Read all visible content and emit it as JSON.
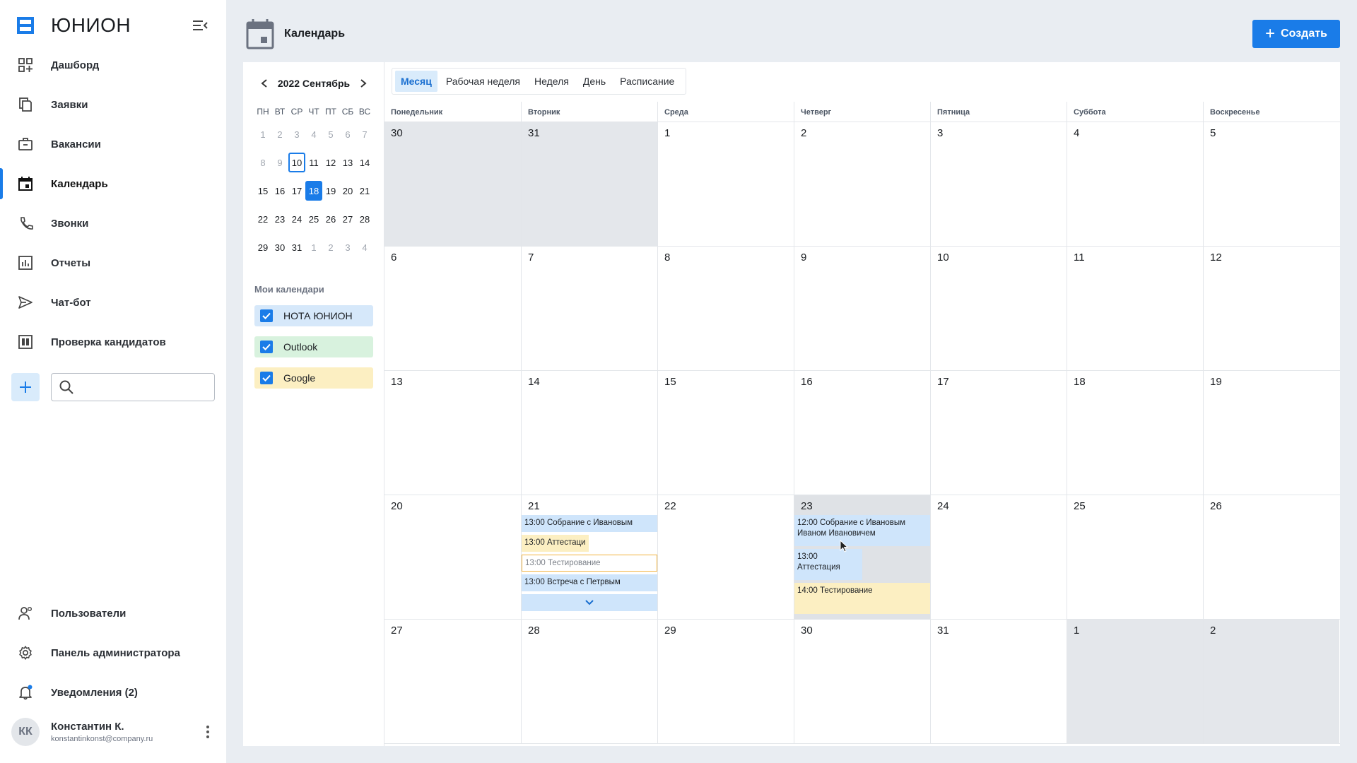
{
  "brand": {
    "name": "ЮНИОН"
  },
  "nav": [
    {
      "label": "Дашборд",
      "icon": "dashboard-icon"
    },
    {
      "label": "Заявки",
      "icon": "documents-icon"
    },
    {
      "label": "Вакансии",
      "icon": "briefcase-icon"
    },
    {
      "label": "Календарь",
      "icon": "calendar-icon",
      "active": true
    },
    {
      "label": "Звонки",
      "icon": "phone-icon"
    },
    {
      "label": "Отчеты",
      "icon": "reports-icon"
    },
    {
      "label": "Чат-бот",
      "icon": "send-icon"
    },
    {
      "label": "Проверка кандидатов",
      "icon": "candidates-icon"
    }
  ],
  "search": {
    "value": "",
    "placeholder": ""
  },
  "bottom_nav": [
    {
      "label": "Пользователи",
      "icon": "users-icon"
    },
    {
      "label": "Панель администратора",
      "icon": "gear-icon"
    },
    {
      "label": "Уведомления (2)",
      "icon": "bell-icon"
    }
  ],
  "user": {
    "initials": "КК",
    "name": "Константин К.",
    "email": "konstantinkonst@company.ru"
  },
  "header": {
    "title": "Календарь",
    "create_label": "Создать"
  },
  "mini_calendar": {
    "year_month": "2022 Сентябрь",
    "dow": [
      "ПН",
      "ВТ",
      "СР",
      "ЧТ",
      "ПТ",
      "СБ",
      "ВС"
    ],
    "weeks": [
      [
        "1",
        "2",
        "3",
        "4",
        "5",
        "6",
        "7"
      ],
      [
        "8",
        "9",
        "10",
        "11",
        "12",
        "13",
        "14"
      ],
      [
        "15",
        "16",
        "17",
        "18",
        "19",
        "20",
        "21"
      ],
      [
        "22",
        "23",
        "24",
        "25",
        "26",
        "27",
        "28"
      ],
      [
        "29",
        "30",
        "31",
        "1",
        "2",
        "3",
        "4"
      ]
    ]
  },
  "my_calendars": {
    "title": "Мои календари",
    "items": [
      {
        "label": "НОТА ЮНИОН",
        "color": "#d6e8fa"
      },
      {
        "label": "Outlook",
        "color": "#d8f2de"
      },
      {
        "label": "Google",
        "color": "#fcefc2"
      }
    ]
  },
  "view_tabs": [
    "Месяц",
    "Рабочая неделя",
    "Неделя",
    "День",
    "Расписание"
  ],
  "month": {
    "dow": [
      "Понедельник",
      "Вторник",
      "Среда",
      "Четверг",
      "Пятница",
      "Суббота",
      "Воскресенье"
    ],
    "weeks": [
      [
        "30",
        "31",
        "1",
        "2",
        "3",
        "4",
        "5"
      ],
      [
        "6",
        "7",
        "8",
        "9",
        "10",
        "11",
        "12"
      ],
      [
        "13",
        "14",
        "15",
        "16",
        "17",
        "18",
        "19"
      ],
      [
        "20",
        "21",
        "22",
        "23",
        "24",
        "25",
        "26"
      ],
      [
        "27",
        "28",
        "29",
        "30",
        "31",
        "1",
        "2"
      ]
    ],
    "events_21": [
      {
        "text": "13:00 Собрание с Ивановым",
        "style": "blue"
      },
      {
        "text": "13:00 Аттестаци",
        "style": "yellow"
      },
      {
        "text": "13:00 Тестирование",
        "style": "outline"
      },
      {
        "text": "13:00 Встреча с Петрвым",
        "style": "blue"
      }
    ],
    "events_23": [
      {
        "text": "12:00 Собрание с Ивановым Иваном Ивановичем",
        "style": "blue"
      },
      {
        "text": "13:00 Аттестация",
        "style": "blue"
      },
      {
        "text": "14:00 Тестирование",
        "style": "yellow"
      }
    ]
  },
  "colors": {
    "accent": "#1a7ce8",
    "event_blue": "#cfe5fb",
    "event_yellow": "#fcefc2"
  }
}
